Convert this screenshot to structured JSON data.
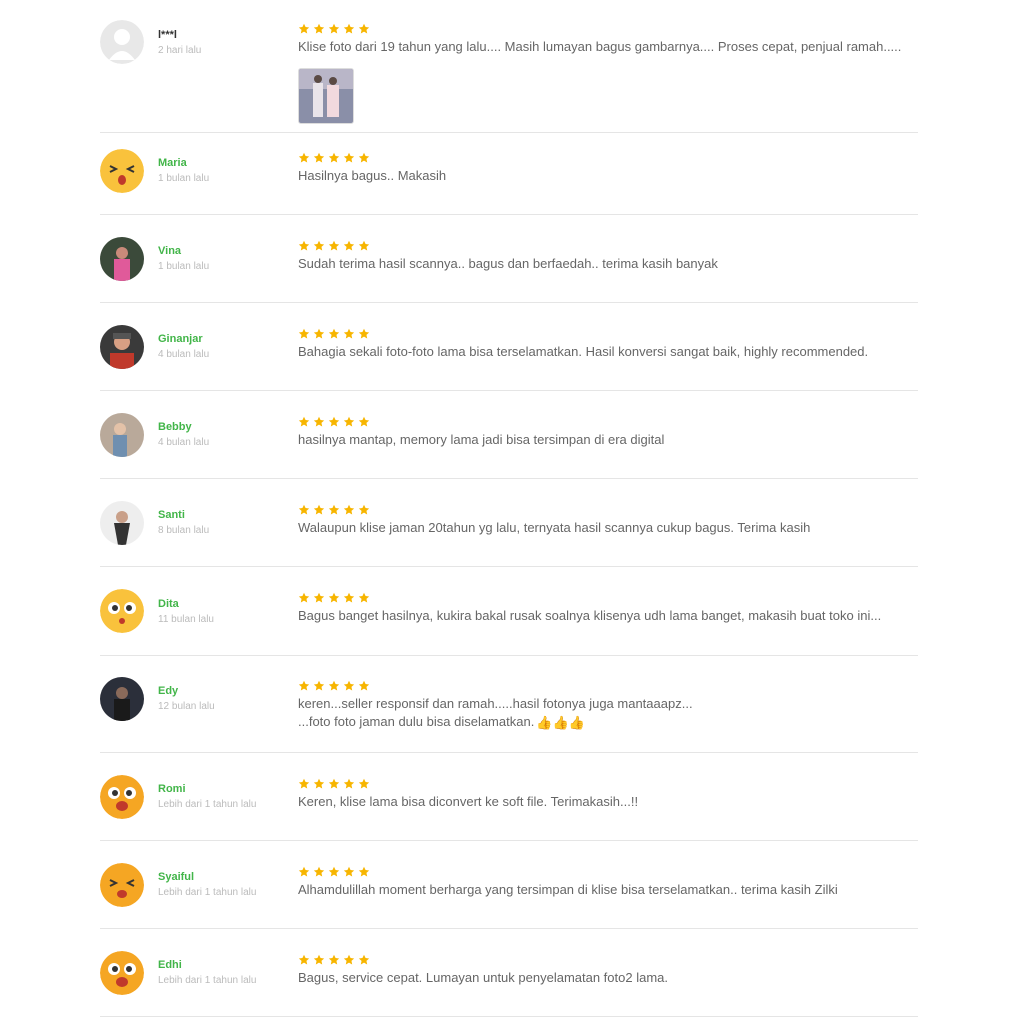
{
  "colors": {
    "accent_green": "#42b549",
    "star": "#f7b500",
    "divider": "#e5e5e5"
  },
  "reviews": [
    {
      "name": "l***l",
      "time": "2 hari lalu",
      "rating": 5,
      "text": "Klise foto dari 19 tahun yang lalu.... Masih lumayan bagus gambarnya.... Proses cepat, penjual ramah.....",
      "avatar": "default-avatar-icon",
      "attachment": "photo-thumbnail"
    },
    {
      "name": "Maria",
      "time": "1 bulan lalu",
      "rating": 5,
      "text": "Hasilnya bagus.. Makasih",
      "avatar": "emoji-wink-avatar"
    },
    {
      "name": "Vina",
      "time": "1 bulan lalu",
      "rating": 5,
      "text": "Sudah terima hasil scannya.. bagus dan berfaedah.. terima kasih banyak",
      "avatar": "photo-avatar"
    },
    {
      "name": "Ginanjar",
      "time": "4 bulan lalu",
      "rating": 5,
      "text": "Bahagia sekali foto-foto lama bisa terselamatkan. Hasil konversi sangat baik, highly recommended.",
      "avatar": "photo-avatar"
    },
    {
      "name": "Bebby",
      "time": "4 bulan lalu",
      "rating": 5,
      "text": "hasilnya mantap, memory lama jadi bisa tersimpan di era digital",
      "avatar": "photo-avatar"
    },
    {
      "name": "Santi",
      "time": "8 bulan lalu",
      "rating": 5,
      "text": "Walaupun klise jaman 20tahun yg lalu, ternyata hasil scannya cukup bagus. Terima kasih",
      "avatar": "photo-avatar"
    },
    {
      "name": "Dita",
      "time": "11 bulan lalu",
      "rating": 5,
      "text": "Bagus banget hasilnya, kukira bakal rusak soalnya klisenya udh lama banget, makasih buat toko ini...",
      "avatar": "emoji-surprised-avatar"
    },
    {
      "name": "Edy",
      "time": "12 bulan lalu",
      "rating": 5,
      "text": "keren...seller responsif dan ramah.....hasil fotonya juga mantaaapz...",
      "text_line2": "...foto foto jaman dulu bisa diselamatkan.",
      "thumbs": "👍👍👍",
      "avatar": "photo-avatar"
    },
    {
      "name": "Romi",
      "time": "Lebih dari 1 tahun lalu",
      "rating": 5,
      "text": "Keren, klise lama bisa diconvert ke soft file. Terimakasih...!!",
      "avatar": "emoji-surprised-avatar"
    },
    {
      "name": "Syaiful",
      "time": "Lebih dari 1 tahun lalu",
      "rating": 5,
      "text": "Alhamdulillah moment berharga yang tersimpan di klise bisa terselamatkan.. terima kasih Zilki",
      "avatar": "emoji-wink-avatar"
    },
    {
      "name": "Edhi",
      "time": "Lebih dari 1 tahun lalu",
      "rating": 5,
      "text": "Bagus, service cepat. Lumayan untuk penyelamatan foto2 lama.",
      "avatar": "emoji-surprised-avatar"
    }
  ]
}
